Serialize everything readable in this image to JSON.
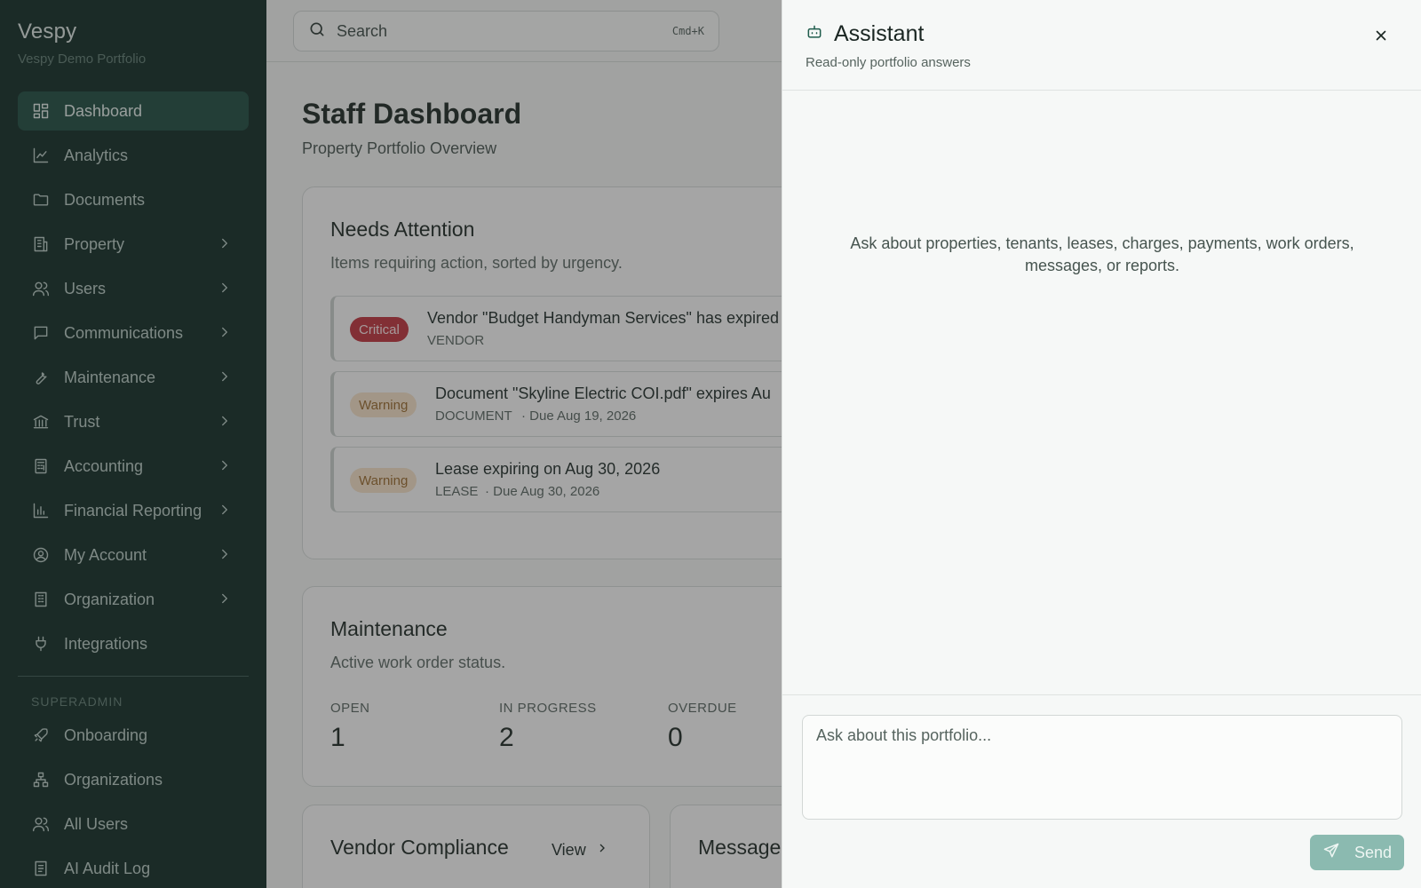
{
  "brand": {
    "name": "Vespy",
    "org": "Vespy Demo Portfolio"
  },
  "sidebar": {
    "items": [
      {
        "label": "Dashboard",
        "icon": "dashboard-icon",
        "active": true
      },
      {
        "label": "Analytics",
        "icon": "line-chart-icon"
      },
      {
        "label": "Documents",
        "icon": "folder-icon"
      },
      {
        "label": "Property",
        "icon": "building-icon",
        "expandable": true
      },
      {
        "label": "Users",
        "icon": "users-icon",
        "expandable": true
      },
      {
        "label": "Communications",
        "icon": "message-icon",
        "expandable": true
      },
      {
        "label": "Maintenance",
        "icon": "wrench-icon",
        "expandable": true
      },
      {
        "label": "Trust",
        "icon": "bank-icon",
        "expandable": true
      },
      {
        "label": "Accounting",
        "icon": "calculator-icon",
        "expandable": true
      },
      {
        "label": "Financial Reporting",
        "icon": "bar-chart-icon",
        "expandable": true
      },
      {
        "label": "My Account",
        "icon": "user-circle-icon",
        "expandable": true
      },
      {
        "label": "Organization",
        "icon": "office-icon",
        "expandable": true
      },
      {
        "label": "Integrations",
        "icon": "plug-icon"
      }
    ],
    "section_label": "SUPERADMIN",
    "admin_items": [
      {
        "label": "Onboarding",
        "icon": "rocket-icon"
      },
      {
        "label": "Organizations",
        "icon": "network-icon"
      },
      {
        "label": "All Users",
        "icon": "users-icon"
      },
      {
        "label": "AI Audit Log",
        "icon": "log-icon"
      }
    ]
  },
  "search": {
    "placeholder": "Search",
    "shortcut": "Cmd+K"
  },
  "page": {
    "title": "Staff Dashboard",
    "subtitle": "Property Portfolio Overview"
  },
  "attention": {
    "title": "Needs Attention",
    "subtitle": "Items requiring action, sorted by urgency.",
    "items": [
      {
        "severity": "Critical",
        "title": "Vendor \"Budget Handyman Services\" has expired",
        "type": "VENDOR",
        "due": ""
      },
      {
        "severity": "Warning",
        "title": "Document \"Skyline Electric COI.pdf\" expires Au",
        "type": "DOCUMENT",
        "due": "· Due Aug 19, 2026"
      },
      {
        "severity": "Warning",
        "title": "Lease expiring on Aug 30, 2026",
        "type": "LEASE",
        "due": "· Due Aug 30, 2026"
      }
    ]
  },
  "maintenance": {
    "title": "Maintenance",
    "subtitle": "Active work order status.",
    "stats": [
      {
        "label": "OPEN",
        "value": "1"
      },
      {
        "label": "IN PROGRESS",
        "value": "2"
      },
      {
        "label": "OVERDUE",
        "value": "0"
      }
    ]
  },
  "vendor_compliance": {
    "title": "Vendor Compliance",
    "view_label": "View"
  },
  "messages_card": {
    "title": "Message"
  },
  "assistant": {
    "title": "Assistant",
    "subtitle": "Read-only portfolio answers",
    "empty_message": "Ask about properties, tenants, leases, charges, payments, work orders, messages, or reports.",
    "input_placeholder": "Ask about this portfolio...",
    "send_label": "Send"
  },
  "colors": {
    "sidebar_bg": "#0e2a24",
    "active_item": "#1c4a3f",
    "critical": "#c0313b",
    "warning_bg": "#f6e2c8",
    "send_button": "#8bbab0"
  }
}
